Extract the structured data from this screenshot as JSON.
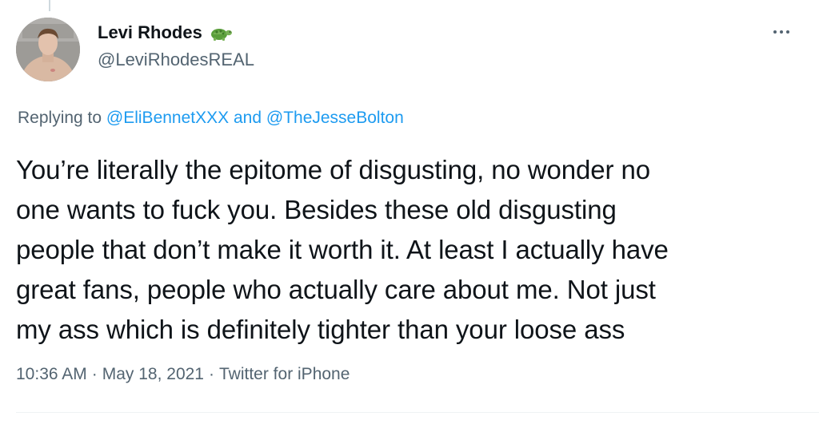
{
  "author": {
    "display_name": "Levi Rhodes",
    "handle": "@LeviRhodesREAL",
    "name_emoji": "turtle-emoji"
  },
  "reply_context": {
    "prefix": "Replying to",
    "mention_1": "@EliBennetXXX",
    "joiner": "and",
    "mention_2": "@TheJesseBolton"
  },
  "tweet": {
    "lines": [
      "You’re literally the epitome of disgusting, no wonder no",
      "one wants to fuck you. Besides these old disgusting",
      "people that don’t make it worth it. At least I actually have",
      "great fans, people who actually care about me. Not just",
      "my ass which is definitely tighter than your loose ass"
    ]
  },
  "meta": {
    "time": "10:36 AM",
    "date": "May 18, 2021",
    "source": "Twitter for iPhone",
    "separator": "·"
  },
  "icons": {
    "more": "more-horizontal-icon"
  },
  "colors": {
    "link": "#1d9bf0",
    "secondary_text": "#536471",
    "primary_text": "#0f1419"
  }
}
